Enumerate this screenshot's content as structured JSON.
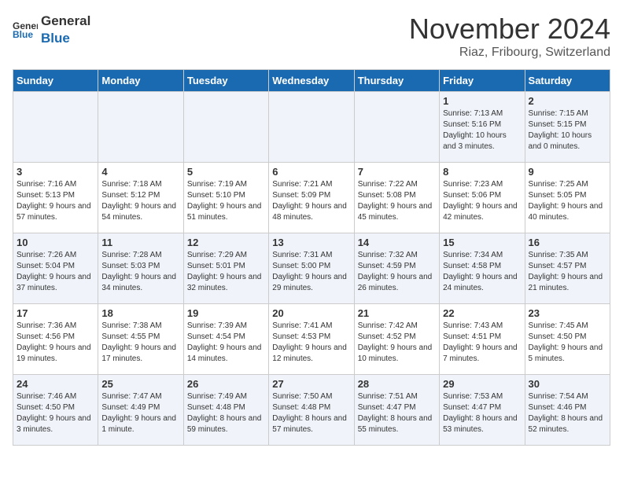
{
  "logo": {
    "line1": "General",
    "line2": "Blue"
  },
  "title": "November 2024",
  "location": "Riaz, Fribourg, Switzerland",
  "weekdays": [
    "Sunday",
    "Monday",
    "Tuesday",
    "Wednesday",
    "Thursday",
    "Friday",
    "Saturday"
  ],
  "weeks": [
    [
      {
        "day": "",
        "info": ""
      },
      {
        "day": "",
        "info": ""
      },
      {
        "day": "",
        "info": ""
      },
      {
        "day": "",
        "info": ""
      },
      {
        "day": "",
        "info": ""
      },
      {
        "day": "1",
        "info": "Sunrise: 7:13 AM\nSunset: 5:16 PM\nDaylight: 10 hours and 3 minutes."
      },
      {
        "day": "2",
        "info": "Sunrise: 7:15 AM\nSunset: 5:15 PM\nDaylight: 10 hours and 0 minutes."
      }
    ],
    [
      {
        "day": "3",
        "info": "Sunrise: 7:16 AM\nSunset: 5:13 PM\nDaylight: 9 hours and 57 minutes."
      },
      {
        "day": "4",
        "info": "Sunrise: 7:18 AM\nSunset: 5:12 PM\nDaylight: 9 hours and 54 minutes."
      },
      {
        "day": "5",
        "info": "Sunrise: 7:19 AM\nSunset: 5:10 PM\nDaylight: 9 hours and 51 minutes."
      },
      {
        "day": "6",
        "info": "Sunrise: 7:21 AM\nSunset: 5:09 PM\nDaylight: 9 hours and 48 minutes."
      },
      {
        "day": "7",
        "info": "Sunrise: 7:22 AM\nSunset: 5:08 PM\nDaylight: 9 hours and 45 minutes."
      },
      {
        "day": "8",
        "info": "Sunrise: 7:23 AM\nSunset: 5:06 PM\nDaylight: 9 hours and 42 minutes."
      },
      {
        "day": "9",
        "info": "Sunrise: 7:25 AM\nSunset: 5:05 PM\nDaylight: 9 hours and 40 minutes."
      }
    ],
    [
      {
        "day": "10",
        "info": "Sunrise: 7:26 AM\nSunset: 5:04 PM\nDaylight: 9 hours and 37 minutes."
      },
      {
        "day": "11",
        "info": "Sunrise: 7:28 AM\nSunset: 5:03 PM\nDaylight: 9 hours and 34 minutes."
      },
      {
        "day": "12",
        "info": "Sunrise: 7:29 AM\nSunset: 5:01 PM\nDaylight: 9 hours and 32 minutes."
      },
      {
        "day": "13",
        "info": "Sunrise: 7:31 AM\nSunset: 5:00 PM\nDaylight: 9 hours and 29 minutes."
      },
      {
        "day": "14",
        "info": "Sunrise: 7:32 AM\nSunset: 4:59 PM\nDaylight: 9 hours and 26 minutes."
      },
      {
        "day": "15",
        "info": "Sunrise: 7:34 AM\nSunset: 4:58 PM\nDaylight: 9 hours and 24 minutes."
      },
      {
        "day": "16",
        "info": "Sunrise: 7:35 AM\nSunset: 4:57 PM\nDaylight: 9 hours and 21 minutes."
      }
    ],
    [
      {
        "day": "17",
        "info": "Sunrise: 7:36 AM\nSunset: 4:56 PM\nDaylight: 9 hours and 19 minutes."
      },
      {
        "day": "18",
        "info": "Sunrise: 7:38 AM\nSunset: 4:55 PM\nDaylight: 9 hours and 17 minutes."
      },
      {
        "day": "19",
        "info": "Sunrise: 7:39 AM\nSunset: 4:54 PM\nDaylight: 9 hours and 14 minutes."
      },
      {
        "day": "20",
        "info": "Sunrise: 7:41 AM\nSunset: 4:53 PM\nDaylight: 9 hours and 12 minutes."
      },
      {
        "day": "21",
        "info": "Sunrise: 7:42 AM\nSunset: 4:52 PM\nDaylight: 9 hours and 10 minutes."
      },
      {
        "day": "22",
        "info": "Sunrise: 7:43 AM\nSunset: 4:51 PM\nDaylight: 9 hours and 7 minutes."
      },
      {
        "day": "23",
        "info": "Sunrise: 7:45 AM\nSunset: 4:50 PM\nDaylight: 9 hours and 5 minutes."
      }
    ],
    [
      {
        "day": "24",
        "info": "Sunrise: 7:46 AM\nSunset: 4:50 PM\nDaylight: 9 hours and 3 minutes."
      },
      {
        "day": "25",
        "info": "Sunrise: 7:47 AM\nSunset: 4:49 PM\nDaylight: 9 hours and 1 minute."
      },
      {
        "day": "26",
        "info": "Sunrise: 7:49 AM\nSunset: 4:48 PM\nDaylight: 8 hours and 59 minutes."
      },
      {
        "day": "27",
        "info": "Sunrise: 7:50 AM\nSunset: 4:48 PM\nDaylight: 8 hours and 57 minutes."
      },
      {
        "day": "28",
        "info": "Sunrise: 7:51 AM\nSunset: 4:47 PM\nDaylight: 8 hours and 55 minutes."
      },
      {
        "day": "29",
        "info": "Sunrise: 7:53 AM\nSunset: 4:47 PM\nDaylight: 8 hours and 53 minutes."
      },
      {
        "day": "30",
        "info": "Sunrise: 7:54 AM\nSunset: 4:46 PM\nDaylight: 8 hours and 52 minutes."
      }
    ]
  ]
}
